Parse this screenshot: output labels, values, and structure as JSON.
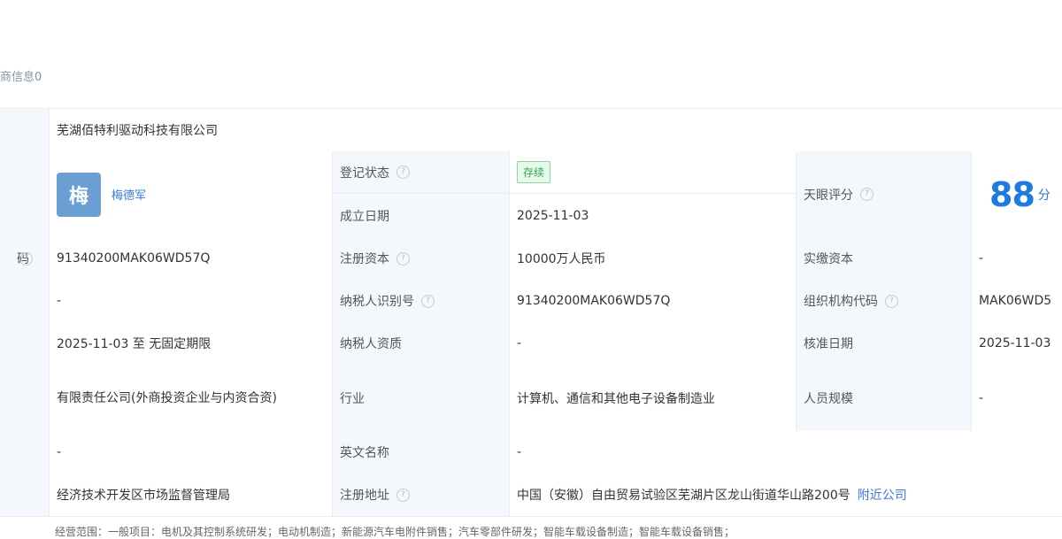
{
  "section": {
    "title": "商信息0"
  },
  "company": {
    "name": "芜湖佰特利驱动科技有限公司"
  },
  "legal_rep": {
    "avatar_char": "梅",
    "name": "梅德军"
  },
  "labels": {
    "reg_status": "登记状态",
    "founded": "成立日期",
    "tianyan_score": "天眼评分",
    "credit_code_fragment": "码",
    "reg_capital": "注册资本",
    "paid_capital": "实缴资本",
    "taxpayer_id": "纳税人识别号",
    "org_code": "组织机构代码",
    "taxpayer_qual": "纳税人资质",
    "approve_date": "核准日期",
    "industry": "行业",
    "staff_size": "人员规模",
    "english_name": "英文名称",
    "reg_address": "注册地址"
  },
  "values": {
    "reg_status": "存续",
    "founded": "2025-11-03",
    "score_number": "88",
    "score_unit": "分",
    "credit_code": "91340200MAK06WD57Q",
    "reg_capital": "10000万人民币",
    "paid_capital": "-",
    "row4_left": "-",
    "taxpayer_id": "91340200MAK06WD57Q",
    "org_code": "MAK06WD5",
    "business_term": "2025-11-03 至 无固定期限",
    "taxpayer_qual": "-",
    "approve_date": "2025-11-03",
    "company_type": "有限责任公司(外商投资企业与内资合资)",
    "industry": "计算机、通信和其他电子设备制造业",
    "staff_size": "-",
    "row7_left": "-",
    "english_name": "-",
    "reg_authority": "经济技术开发区市场监督管理局",
    "reg_address": "中国（安徽）自由贸易试验区芜湖片区龙山街道华山路200号",
    "nearby_link": "附近公司"
  },
  "footer": {
    "text": "经营范围：一般项目：电机及其控制系统研发；电动机制造；新能源汽车电附件销售；汽车零部件研发；智能车载设备制造；智能车载设备销售；"
  }
}
